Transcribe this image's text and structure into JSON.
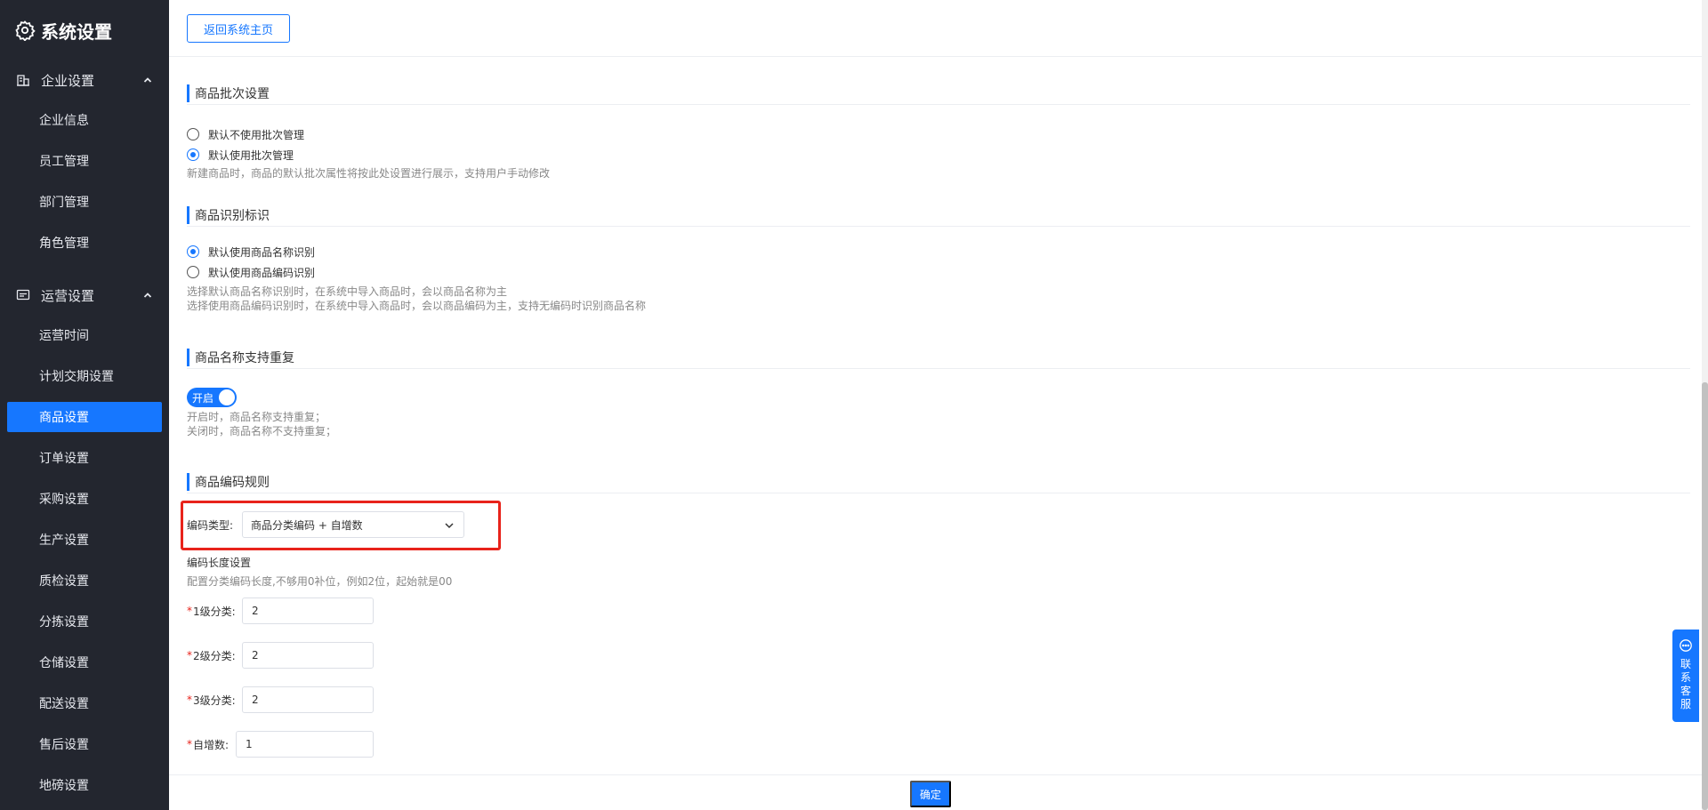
{
  "sidebar": {
    "title": "系统设置",
    "groups": [
      {
        "label": "企业设置",
        "icon": "building-icon"
      },
      {
        "label": "运营设置",
        "icon": "monitor-icon"
      }
    ],
    "items": [
      {
        "label": "企业信息"
      },
      {
        "label": "员工管理"
      },
      {
        "label": "部门管理"
      },
      {
        "label": "角色管理"
      },
      {
        "label": "运营时间"
      },
      {
        "label": "计划交期设置"
      },
      {
        "label": "商品设置"
      },
      {
        "label": "订单设置"
      },
      {
        "label": "采购设置"
      },
      {
        "label": "生产设置"
      },
      {
        "label": "质检设置"
      },
      {
        "label": "分拣设置"
      },
      {
        "label": "仓储设置"
      },
      {
        "label": "配送设置"
      },
      {
        "label": "售后设置"
      },
      {
        "label": "地磅设置"
      }
    ],
    "active_item": "商品设置"
  },
  "header": {
    "back_label": "返回系统主页"
  },
  "batch": {
    "title": "商品批次设置",
    "options": [
      "默认不使用批次管理",
      "默认使用批次管理"
    ],
    "selected": "默认使用批次管理",
    "hint": "新建商品时，商品的默认批次属性将按此处设置进行展示，支持用户手动修改"
  },
  "identify": {
    "title": "商品识别标识",
    "options": [
      "默认使用商品名称识别",
      "默认使用商品编码识别"
    ],
    "selected": "默认使用商品名称识别",
    "hints": [
      "选择默认商品名称识别时，在系统中导入商品时，会以商品名称为主",
      "选择使用商品编码识别时，在系统中导入商品时，会以商品编码为主，支持无编码时识别商品名称"
    ]
  },
  "duplicate": {
    "title": "商品名称支持重复",
    "switch_label": "开启",
    "switch_on": true,
    "hints": [
      "开启时，商品名称支持重复；",
      "关闭时，商品名称不支持重复；"
    ]
  },
  "code_rule": {
    "title": "商品编码规则",
    "type_label": "编码类型:",
    "type_value": "商品分类编码 + 自增数",
    "length_title": "编码长度设置",
    "length_hint": "配置分类编码长度,不够用0补位，例如2位，起始就是00",
    "required_mark": "*",
    "fields": [
      {
        "label": "1级分类:",
        "value": "2"
      },
      {
        "label": "2级分类:",
        "value": "2"
      },
      {
        "label": "3级分类:",
        "value": "2"
      },
      {
        "label": "自增数:",
        "value": "1"
      }
    ]
  },
  "footer": {
    "confirm_label": "确定"
  },
  "customer_service": {
    "label": "联系客服"
  },
  "colors": {
    "accent": "#1677ff",
    "sidebar_bg": "#23262f",
    "highlight": "#e8231b"
  }
}
